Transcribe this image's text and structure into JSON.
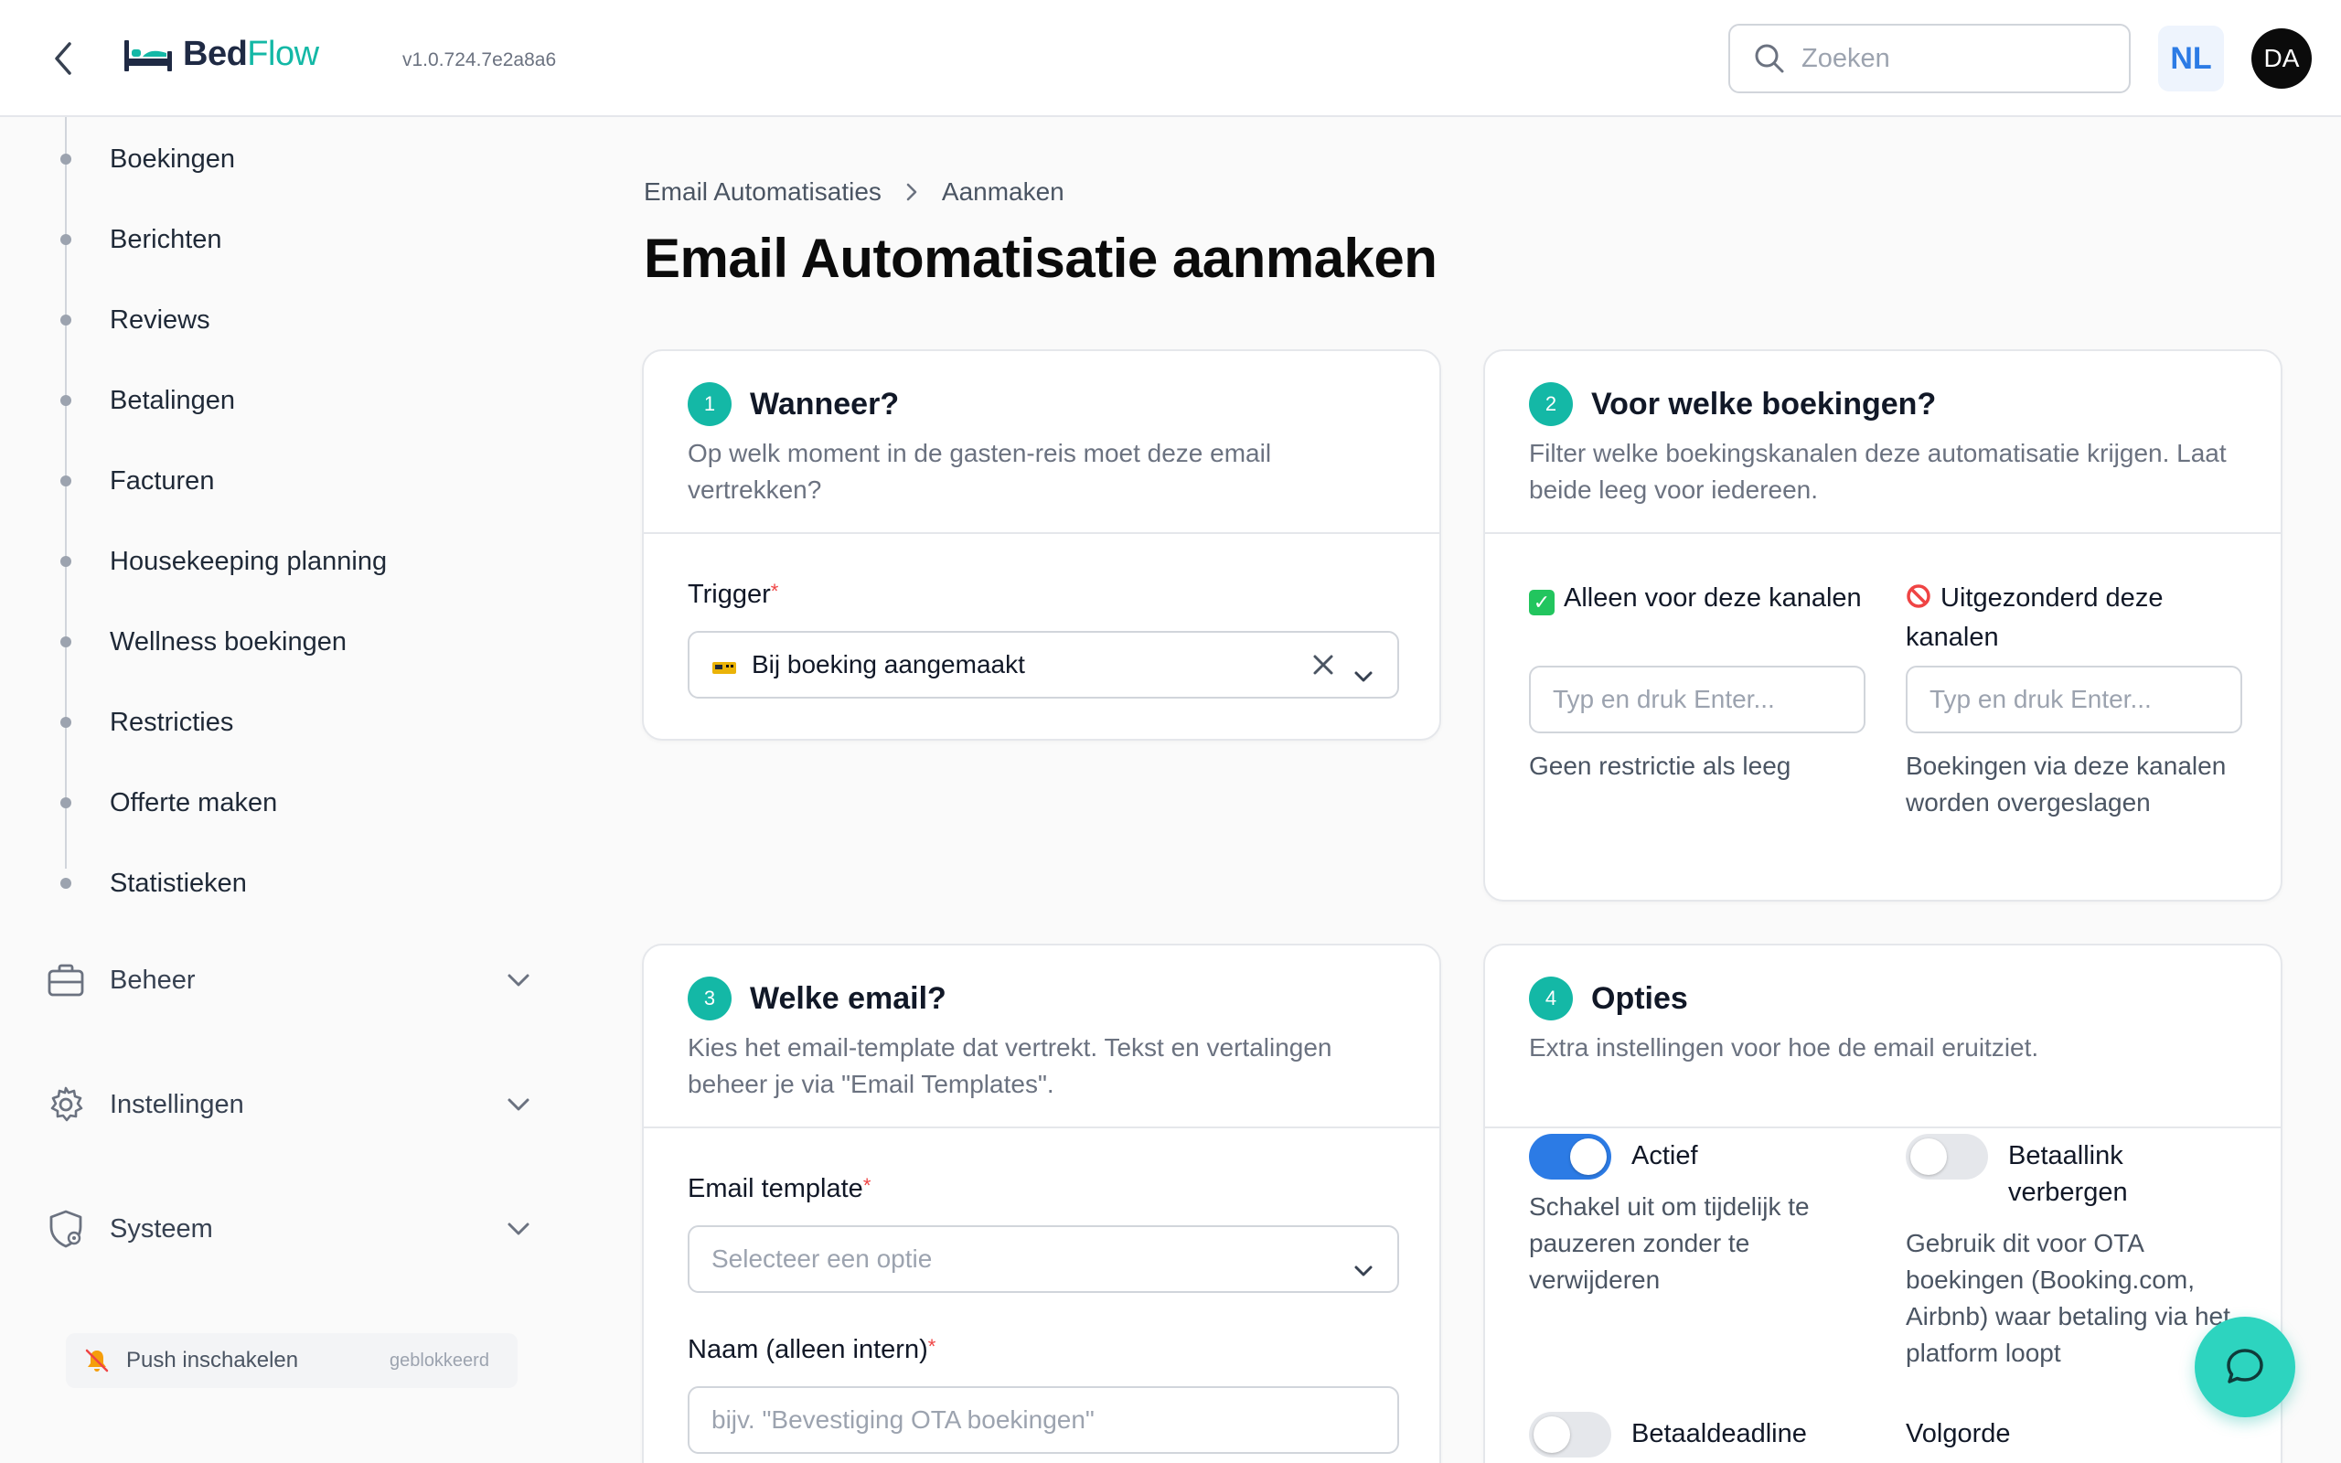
{
  "header": {
    "logo_bed": "Bed",
    "logo_flow": "Flow",
    "version": "v1.0.724.7e2a8a6",
    "search_placeholder": "Zoeken",
    "lang": "NL",
    "avatar_initials": "DA"
  },
  "sidebar": {
    "subitems": [
      "Boekingen",
      "Berichten",
      "Reviews",
      "Betalingen",
      "Facturen",
      "Housekeeping planning",
      "Wellness boekingen",
      "Restricties",
      "Offerte maken",
      "Statistieken"
    ],
    "groups": [
      {
        "label": "Beheer",
        "icon": "briefcase-icon"
      },
      {
        "label": "Instellingen",
        "icon": "gear-icon"
      },
      {
        "label": "Systeem",
        "icon": "shield-gear-icon"
      }
    ],
    "push": {
      "label": "Push inschakelen",
      "status": "geblokkeerd"
    }
  },
  "breadcrumb": {
    "parent": "Email Automatisaties",
    "current": "Aanmaken"
  },
  "page_title": "Email Automatisatie aanmaken",
  "card1": {
    "step": "1",
    "title": "Wanneer?",
    "desc": "Op welk moment in de gasten-reis moet deze email vertrekken?",
    "trigger_label": "Trigger",
    "trigger_value": "Bij boeking aangemaakt"
  },
  "card2": {
    "step": "2",
    "title": "Voor welke boekingen?",
    "desc": "Filter welke boekingskanalen deze automatisatie krijgen. Laat beide leeg voor iedereen.",
    "include_label": "Alleen voor deze kanalen",
    "include_placeholder": "Typ en druk Enter...",
    "include_helper": "Geen restrictie als leeg",
    "exclude_label": "Uitgezonderd deze kanalen",
    "exclude_placeholder": "Typ en druk Enter...",
    "exclude_helper": "Boekingen via deze kanalen worden overgeslagen"
  },
  "card3": {
    "step": "3",
    "title": "Welke email?",
    "desc": "Kies het email-template dat vertrekt. Tekst en vertalingen beheer je via \"Email Templates\".",
    "template_label": "Email template",
    "template_placeholder": "Selecteer een optie",
    "name_label": "Naam (alleen intern)",
    "name_placeholder": "bijv. \"Bevestiging OTA boekingen\""
  },
  "card4": {
    "step": "4",
    "title": "Opties",
    "desc": "Extra instellingen voor hoe de email eruitziet.",
    "actief_label": "Actief",
    "actief_on": true,
    "actief_helper": "Schakel uit om tijdelijk te pauzeren zonder te verwijderen",
    "betaallink_label": "Betaallink verbergen",
    "betaallink_on": false,
    "betaallink_helper": "Gebruik dit voor OTA boekingen (Booking.com, Airbnb) waar betaling via het platform loopt",
    "deadline_label": "Betaaldeadline",
    "deadline_on": false,
    "volgorde_label": "Volgorde"
  },
  "colors": {
    "accent": "#14b8a6",
    "toggle_on": "#2c7be5",
    "required": "#ef4444"
  }
}
